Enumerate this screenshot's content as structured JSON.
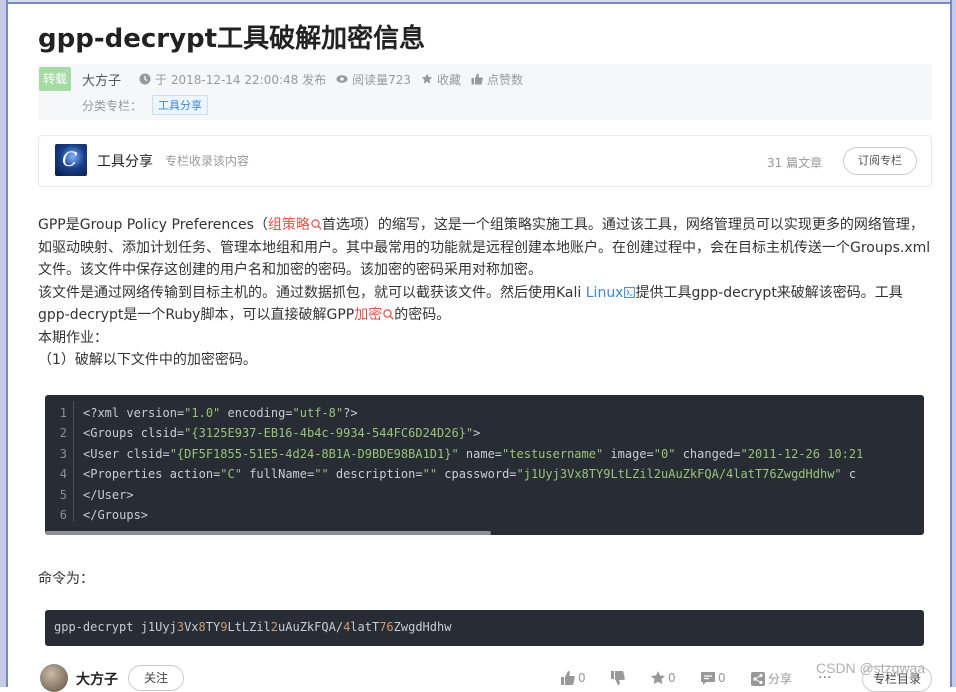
{
  "article": {
    "title": "gpp-decrypt工具破解加密信息",
    "badge": "转载",
    "author": "大方子",
    "published": "于 2018-12-14 22:00:48 发布",
    "reads": "阅读量723",
    "favorite": "收藏",
    "likes": "点赞数",
    "category_label": "分类专栏：",
    "category_tag": "工具分享"
  },
  "column": {
    "name": "工具分享",
    "subtitle": "专栏收录该内容",
    "count": "31 篇文章",
    "subscribe": "订阅专栏"
  },
  "body": {
    "p1_a": "GPP是Group Policy Preferences（",
    "p1_kw": "组策略",
    "p1_b": "首选项）的缩写，这是一个组策略实施工具。通过该工具，网络管理员可以实现更多的网络管理，如驱动映射、添加计划任务、管理本地组和用户。其中最常用的功能就是远程创建本地账户。在创建过程中，会在目标主机传送一个Groups.xml文件。该文件中保存这创建的用户名和加密的密码。该加密的密码采用对称加密。",
    "p2_a": "该文件是通过网络传输到目标主机的。通过数据抓包，就可以截获该文件。然后使用Kali ",
    "p2_kw1": "Linux",
    "p2_b": "提供工具gpp-decrypt来破解该密码。工具gpp-decrypt是一个Ruby脚本，可以直接破解GPP",
    "p2_kw2": "加密",
    "p2_c": "的密码。",
    "p3": "本期作业：",
    "p4": "（1）破解以下文件中的加密密码。",
    "cmd_label": "命令为："
  },
  "code": {
    "lines": [
      {
        "n": "1",
        "parts": [
          [
            "t",
            "<?xml version="
          ],
          [
            "s",
            "\"1.0\""
          ],
          [
            "t",
            " encoding="
          ],
          [
            "s",
            "\"utf-8\""
          ],
          [
            "t",
            "?>"
          ]
        ]
      },
      {
        "n": "2",
        "parts": [
          [
            "t",
            "<Groups clsid="
          ],
          [
            "s",
            "\"{3125E937-EB16-4b4c-9934-544FC6D24D26}\""
          ],
          [
            "t",
            ">"
          ]
        ]
      },
      {
        "n": "3",
        "parts": [
          [
            "t",
            "<User clsid="
          ],
          [
            "s",
            "\"{DF5F1855-51E5-4d24-8B1A-D9BDE98BA1D1}\""
          ],
          [
            "t",
            " name="
          ],
          [
            "s",
            "\"testusername\""
          ],
          [
            "t",
            " image="
          ],
          [
            "s",
            "\"0\""
          ],
          [
            "t",
            " changed="
          ],
          [
            "s",
            "\"2011-12-26 10:21"
          ]
        ]
      },
      {
        "n": "4",
        "parts": [
          [
            "t",
            "<Properties action="
          ],
          [
            "s",
            "\"C\""
          ],
          [
            "t",
            " fullName="
          ],
          [
            "s",
            "\"\""
          ],
          [
            "t",
            " description="
          ],
          [
            "s",
            "\"\""
          ],
          [
            "t",
            "  cpassword="
          ],
          [
            "s",
            "\"j1Uyj3Vx8TY9LtLZil2uAuZkFQA/4latT76ZwgdHdhw\""
          ],
          [
            "t",
            " c"
          ]
        ]
      },
      {
        "n": "5",
        "parts": [
          [
            "t",
            "</User>"
          ]
        ]
      },
      {
        "n": "6",
        "parts": [
          [
            "t",
            "</Groups>"
          ]
        ]
      }
    ]
  },
  "command": {
    "parts": [
      [
        "t",
        "gpp-decrypt j1Uyj"
      ],
      [
        "n",
        "3"
      ],
      [
        "t",
        "Vx"
      ],
      [
        "n",
        "8"
      ],
      [
        "t",
        "TY"
      ],
      [
        "n",
        "9"
      ],
      [
        "t",
        "LtLZil"
      ],
      [
        "n",
        "2"
      ],
      [
        "t",
        "uAuZkFQA/"
      ],
      [
        "n",
        "4"
      ],
      [
        "t",
        "latT"
      ],
      [
        "n",
        "76"
      ],
      [
        "t",
        "ZwgdHdhw"
      ]
    ]
  },
  "bottom": {
    "author": "大方子",
    "follow": "关注",
    "like_count": "0",
    "dislike_count": "",
    "fav_count": "0",
    "comment_count": "0",
    "share": "分享",
    "more": "···",
    "toc": "专栏目录",
    "watermark": "CSDN @stzqwaa"
  },
  "colors": {
    "keyword_red": "#e2524a",
    "keyword_blue": "#3a86d8",
    "code_bg": "#282c34",
    "code_string": "#98c379",
    "code_number": "#d19a66"
  }
}
